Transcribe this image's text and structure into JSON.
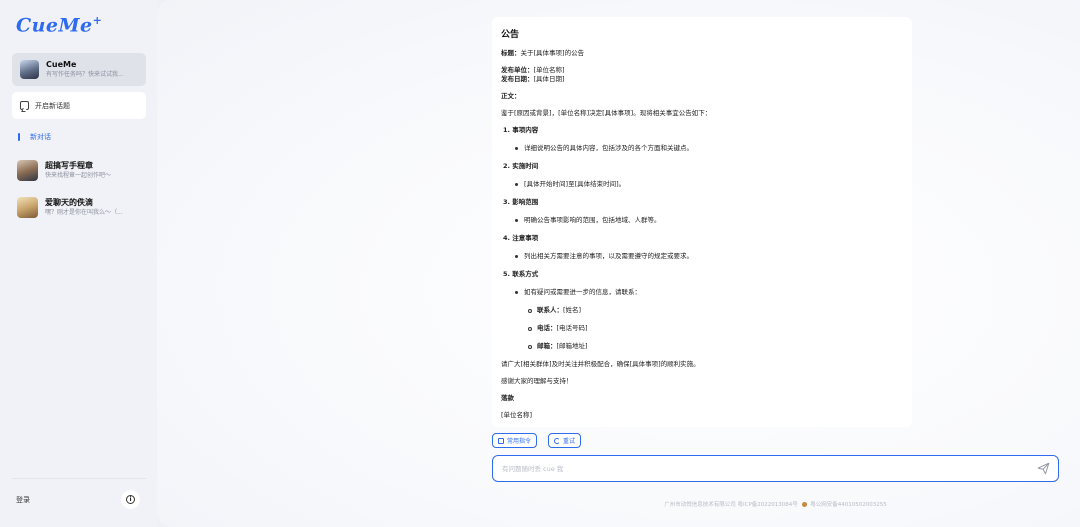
{
  "sidebar": {
    "logo": "CueMe",
    "logo_mark": "+",
    "bot": {
      "name": "CueMe",
      "desc": "有写作任务吗？快来试试我..."
    },
    "new_topic": "开启新话题",
    "current_chat": "新对话",
    "agents": [
      {
        "name": "超搞写手程章",
        "desc": "快来找程章一起创作吧～"
      },
      {
        "name": "爱聊天的佚滴",
        "desc": "嘿？刚才是你在叫我么～（..."
      }
    ],
    "login": "登录",
    "info_icon": "i"
  },
  "document": {
    "heading": "公告",
    "title_label": "标题：",
    "title_value": "关于[具体事项]的公告",
    "issuer_label": "发布单位：",
    "issuer_value": "[单位名称]",
    "date_label": "发布日期：",
    "date_value": "[具体日期]",
    "body_label": "正文：",
    "intro": "鉴于[原因或背景]，[单位名称]决定[具体事项]。现将相关事宜公告如下：",
    "sections": [
      {
        "title": "1. 事项内容",
        "bullet": "详细说明公告的具体内容，包括涉及的各个方面和关键点。"
      },
      {
        "title": "2. 实施时间",
        "bullet": "[具体开始时间]至[具体结束时间]。"
      },
      {
        "title": "3. 影响范围",
        "bullet": "明确公告事项影响的范围，包括地域、人群等。"
      },
      {
        "title": "4. 注意事项",
        "bullet": "列出相关方需要注意的事项，以及需要遵守的规定或要求。"
      },
      {
        "title": "5. 联系方式",
        "bullet": "如有疑问或需要进一步的信息，请联系："
      }
    ],
    "contacts": [
      {
        "label": "联系人：",
        "value": "[姓名]"
      },
      {
        "label": "电话：",
        "value": "[电话号码]"
      },
      {
        "label": "邮箱：",
        "value": "[邮箱地址]"
      }
    ],
    "closing1": "请广大[相关群体]及时关注并积极配合，确保[具体事项]的顺利实施。",
    "closing2": "感谢大家的理解与支持！",
    "signoff": "落款",
    "signoff_value": "[单位名称]"
  },
  "actions": {
    "commands": "常用指令",
    "retry": "重试"
  },
  "input": {
    "placeholder": "有问题随时丢 cue 我"
  },
  "footer": {
    "company": "广州市动悦信息技术有限公司 粤ICP备2022013084号",
    "police": "粤公网安备44010502003255"
  },
  "colors": {
    "accent": "#2f6bf0"
  }
}
